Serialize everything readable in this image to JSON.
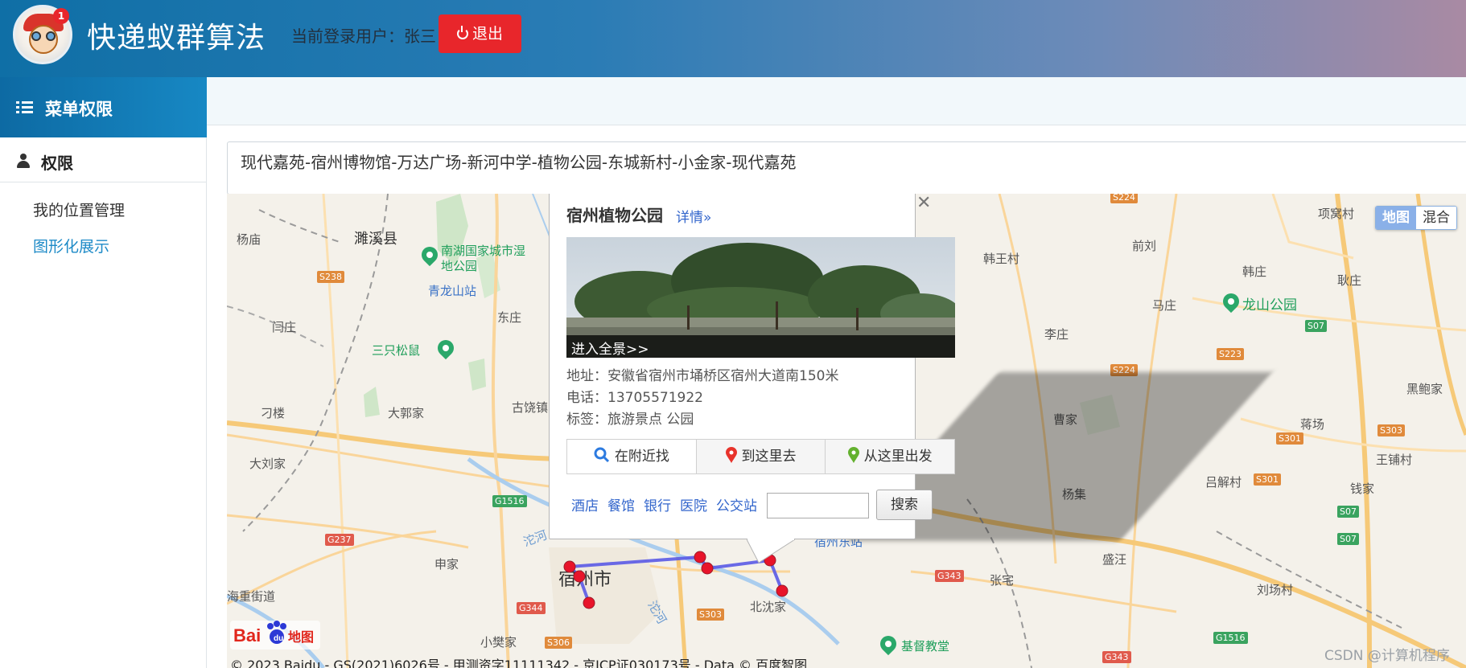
{
  "header": {
    "app_title": "快递蚁群算法",
    "badge_count": "1",
    "user_label": "当前登录用户：张三",
    "logout_label": "退出"
  },
  "sidebar": {
    "section_title": "菜单权限",
    "group_title": "权限",
    "items": [
      {
        "label": "我的位置管理",
        "active": false
      },
      {
        "label": "图形化展示",
        "active": true
      }
    ]
  },
  "main": {
    "route_text": "现代嘉苑-宿州博物馆-万达广场-新河中学-植物公园-东城新村-小金家-现代嘉苑"
  },
  "map": {
    "map_type": {
      "map": "地图",
      "hybrid": "混合",
      "selected": "地图"
    },
    "place_labels": [
      "濉溪县",
      "杨庙",
      "南湖国家城市湿地公园",
      "青龙山站",
      "东庄",
      "闫庄",
      "三只松鼠",
      "大郭家",
      "古饶镇",
      "刁楼",
      "大刘家",
      "申家",
      "宿州市",
      "海重街道",
      "小樊家",
      "北沈家",
      "宿州东站",
      "基督教堂",
      "张宅",
      "盛汪",
      "刘场村",
      "杨集",
      "曹家",
      "李庄",
      "韩王村",
      "前刘",
      "马庄",
      "韩庄",
      "耿庄",
      "龙山公园",
      "项窝村",
      "黑鲍家",
      "蒋场",
      "王铺村",
      "吕解村",
      "钱家",
      "沱河",
      "沱河"
    ],
    "road_shields": [
      "S238",
      "S224",
      "S224",
      "S223",
      "S07",
      "S301",
      "S301",
      "S303",
      "S07",
      "S07",
      "G1516",
      "G237",
      "G344",
      "S306",
      "S303",
      "G343",
      "G343",
      "G1516"
    ],
    "copyright": "© 2023 Baidu - GS(2021)6026号 - 甲测资字11111342 - 京ICP证030173号 - Data © 百度智图",
    "logo_text": "Bai 地图",
    "watermark": "CSDN @计算机程序"
  },
  "info_window": {
    "title": "宿州植物公园",
    "detail_link": "详情»",
    "panorama_label": "进入全景>>",
    "address": "地址：安徽省宿州市埇桥区宿州大道南150米",
    "phone": "电话：13705571922",
    "tags": "标签：旅游景点 公园",
    "tabs": [
      "在附近找",
      "到这里去",
      "从这里出发"
    ],
    "categories": [
      "酒店",
      "餐馆",
      "银行",
      "医院",
      "公交站"
    ],
    "search_button": "搜索",
    "search_value": ""
  },
  "colors": {
    "header_start": "#0f6fa6",
    "header_end": "#a98aa3",
    "sidebar_head": "#1788c4",
    "logout": "#e8262b",
    "active_link": "#1d8ac7",
    "route_line": "#5a5ae6",
    "route_marker": "#e8142a",
    "map_link": "#3366cc"
  }
}
